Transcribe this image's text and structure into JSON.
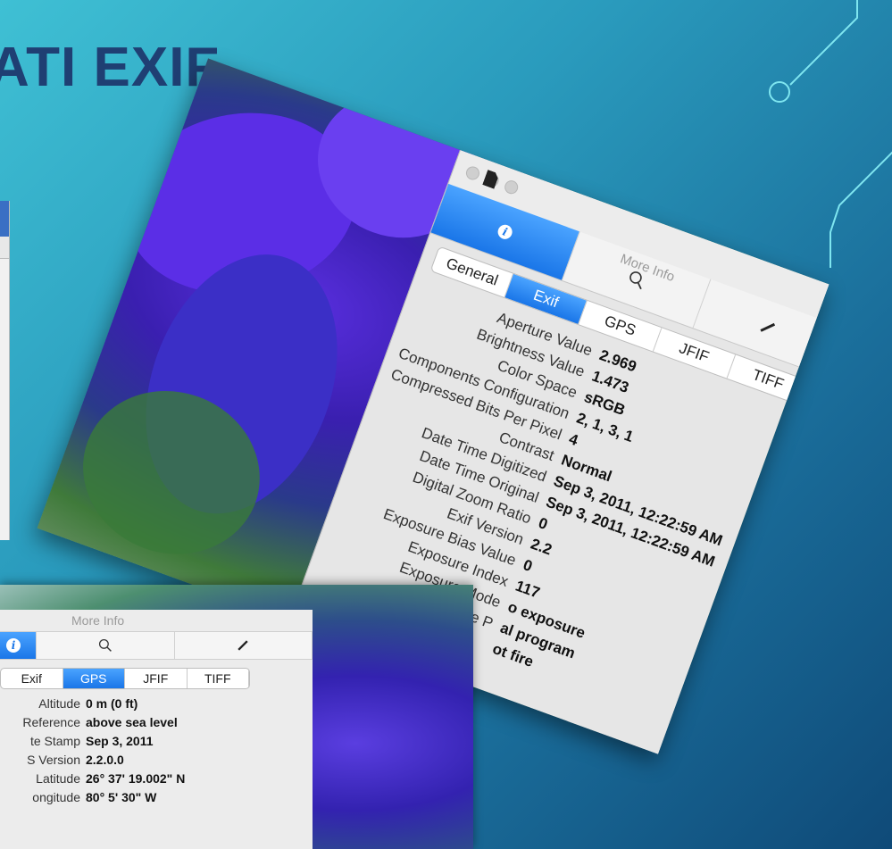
{
  "slide": {
    "title": "ATI EXIF"
  },
  "main_window": {
    "title": "More Info",
    "tabs": [
      {
        "label": "General",
        "active": false
      },
      {
        "label": "Exif",
        "active": true
      },
      {
        "label": "GPS",
        "active": false
      },
      {
        "label": "JFIF",
        "active": false
      },
      {
        "label": "TIFF",
        "active": false
      }
    ],
    "rows": [
      {
        "key": "Aperture Value",
        "value": "2.969"
      },
      {
        "key": "Brightness Value",
        "value": "1.473"
      },
      {
        "key": "Color Space",
        "value": "sRGB"
      },
      {
        "key": "Components Configuration",
        "value": "2, 1, 3, 1"
      },
      {
        "key": "Compressed Bits Per Pixel",
        "value": "4"
      },
      {
        "key": "Contrast",
        "value": "Normal"
      },
      {
        "key": "Date Time Digitized",
        "value": "Sep 3, 2011, 12:22:59 AM"
      },
      {
        "key": "Date Time Original",
        "value": "Sep 3, 2011, 12:22:59 AM"
      },
      {
        "key": "Digital Zoom Ratio",
        "value": "0"
      },
      {
        "key": "Exif Version",
        "value": "2.2"
      },
      {
        "key": "Exposure Bias Value",
        "value": "0"
      },
      {
        "key": "Exposure Index",
        "value": "117"
      },
      {
        "key": "Exposure Mode",
        "value": "o exposure"
      },
      {
        "key": "Exposure P",
        "value": "al program"
      },
      {
        "key": "",
        "value": ""
      },
      {
        "key": "",
        "value": "ot fire"
      }
    ]
  },
  "gps_window": {
    "title": "More Info",
    "tabs": [
      {
        "label": "Exif",
        "active": false
      },
      {
        "label": "GPS",
        "active": true
      },
      {
        "label": "JFIF",
        "active": false
      },
      {
        "label": "TIFF",
        "active": false
      }
    ],
    "rows": [
      {
        "key": "Altitude",
        "value": "0 m (0 ft)"
      },
      {
        "key": "Reference",
        "value": "above sea level"
      },
      {
        "key": "te Stamp",
        "value": "Sep 3, 2011"
      },
      {
        "key": "S Version",
        "value": "2.2.0.0"
      },
      {
        "key": "Latitude",
        "value": "26° 37' 19.002\" N"
      },
      {
        "key": "ongitude",
        "value": "80° 5' 30\" W"
      }
    ]
  },
  "icons": [
    "info-icon",
    "search-icon",
    "pencil-icon",
    "document-icon"
  ],
  "colors": {
    "accent": "#1a76e8",
    "title": "#1f3f73",
    "circuit": "#7fe6f0"
  }
}
